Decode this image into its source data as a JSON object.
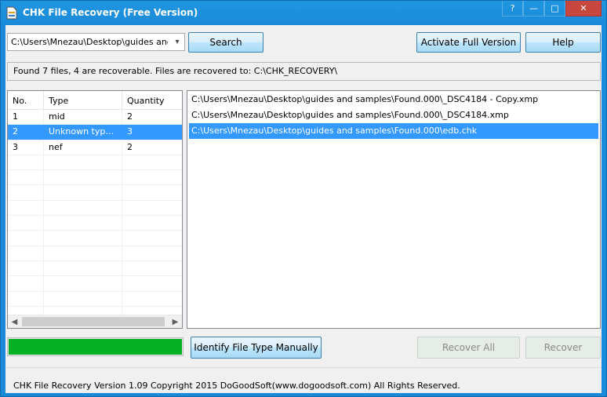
{
  "window": {
    "title": "CHK File Recovery (Free Version)",
    "caption_help": "?",
    "caption_min": "—",
    "caption_max": "□",
    "caption_close": "✕"
  },
  "toolbar": {
    "path_value": "C:\\Users\\Mnezau\\Desktop\\guides and samples",
    "search_label": "Search",
    "activate_label": "Activate Full Version",
    "help_label": "Help"
  },
  "status": {
    "text": "Found 7 files, 4 are recoverable. Files are recovered to: C:\\CHK_RECOVERY\\"
  },
  "types_table": {
    "columns": [
      "No.",
      "Type",
      "Quantity"
    ],
    "rows": [
      {
        "no": "1",
        "type": "mid",
        "quantity": "2"
      },
      {
        "no": "2",
        "type": "Unknown type ...",
        "quantity": "3"
      },
      {
        "no": "3",
        "type": "nef",
        "quantity": "2"
      }
    ],
    "selected_index": 1,
    "empty_rows": 11
  },
  "files_list": {
    "items": [
      "C:\\Users\\Mnezau\\Desktop\\guides and samples\\Found.000\\_DSC4184 - Copy.xmp",
      "C:\\Users\\Mnezau\\Desktop\\guides and samples\\Found.000\\_DSC4184.xmp",
      "C:\\Users\\Mnezau\\Desktop\\guides and samples\\Found.000\\edb.chk"
    ],
    "selected_index": 2
  },
  "progress": {
    "value_percent": 100,
    "color": "#06b025"
  },
  "actions": {
    "identify_label": "Identify File Type Manually",
    "recover_all_label": "Recover All",
    "recover_label": "Recover"
  },
  "footer": {
    "text": "CHK File Recovery Version 1.09  Copyright 2015 DoGoodSoft(www.dogoodsoft.com) All Rights Reserved."
  },
  "icons": {
    "app": "chk-file-icon",
    "combo_arrow": "chevron-down-icon",
    "scroll_left": "chevron-left-icon",
    "scroll_right": "chevron-right-icon"
  },
  "colors": {
    "selection": "#3399ff",
    "title_bar": "#1a8ad8",
    "close_button": "#c7463d"
  }
}
